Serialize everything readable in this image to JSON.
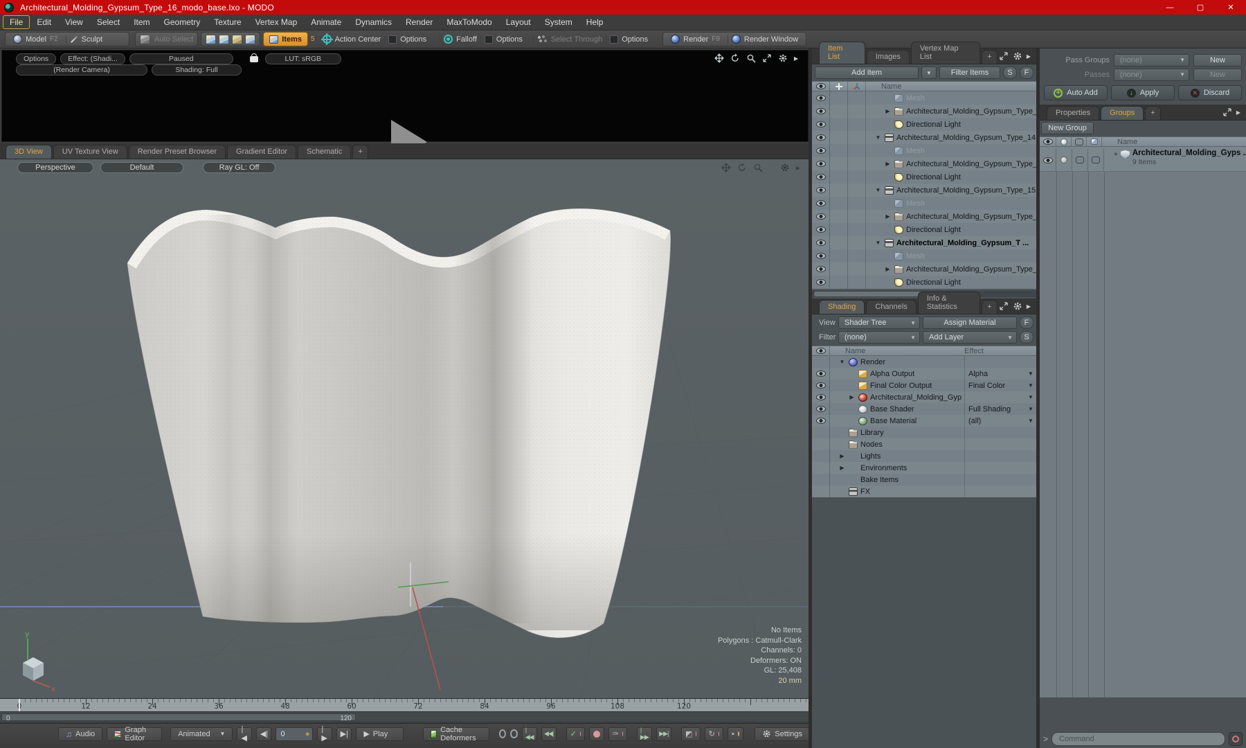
{
  "window": {
    "title": "Architectural_Molding_Gypsum_Type_16_modo_base.lxo - MODO"
  },
  "menu": {
    "items": [
      {
        "label": "File",
        "active": true
      },
      {
        "label": "Edit"
      },
      {
        "label": "View"
      },
      {
        "label": "Select"
      },
      {
        "label": "Item"
      },
      {
        "label": "Geometry"
      },
      {
        "label": "Texture"
      },
      {
        "label": "Vertex Map"
      },
      {
        "label": "Animate"
      },
      {
        "label": "Dynamics"
      },
      {
        "label": "Render"
      },
      {
        "label": "MaxToModo"
      },
      {
        "label": "Layout"
      },
      {
        "label": "System"
      },
      {
        "label": "Help"
      }
    ]
  },
  "toolbar": {
    "model": "Model",
    "model_key": "F2",
    "sculpt": "Sculpt",
    "auto_select": "Auto Select",
    "items": "Items",
    "items_count": "5",
    "action_center": "Action Center",
    "options1": "Options",
    "falloff": "Falloff",
    "options2": "Options",
    "select_through": "Select Through",
    "options3": "Options",
    "render": "Render",
    "render_key": "F9",
    "render_window": "Render Window"
  },
  "preview": {
    "options": "Options",
    "effect": "Effect: (Shadi...",
    "paused": "Paused",
    "lut": "LUT: sRGB",
    "camera": "(Render Camera)",
    "shading": "Shading: Full"
  },
  "viewport": {
    "tabs": [
      {
        "label": "3D View",
        "active": true
      },
      {
        "label": "UV Texture View"
      },
      {
        "label": "Render Preset Browser"
      },
      {
        "label": "Gradient Editor"
      },
      {
        "label": "Schematic"
      },
      {
        "label": "+"
      }
    ],
    "projection": "Perspective",
    "style": "Default",
    "raygl": "Ray GL: Off",
    "stats": [
      {
        "text": "No Items"
      },
      {
        "text": "Polygons : Catmull-Clark"
      },
      {
        "text": "Channels: 0"
      },
      {
        "text": "Deformers: ON"
      },
      {
        "text": "GL: 25,408"
      },
      {
        "text": "20 mm"
      }
    ],
    "gizmo_y_label": "y",
    "gizmo_x_label": "x"
  },
  "timeline": {
    "labels": [
      {
        "v": "0"
      },
      {
        "v": "12"
      },
      {
        "v": "24"
      },
      {
        "v": "36"
      },
      {
        "v": "48"
      },
      {
        "v": "60"
      },
      {
        "v": "72"
      },
      {
        "v": "84"
      },
      {
        "v": "96"
      },
      {
        "v": "108"
      },
      {
        "v": "120"
      }
    ],
    "range_start": "0",
    "range_end": "120"
  },
  "transport": {
    "audio": "Audio",
    "graph_editor": "Graph Editor",
    "anim_mode": "Animated",
    "frame": "0",
    "play": "Play",
    "cache_deformers": "Cache Deformers",
    "settings": "Settings"
  },
  "item_list": {
    "tabs": [
      {
        "label": "Item List",
        "active": true
      },
      {
        "label": "Images"
      },
      {
        "label": "Vertex Map List"
      },
      {
        "label": "+"
      }
    ],
    "add_item": "Add Item",
    "filter_placeholder": "Filter Items",
    "btn_s": "S",
    "btn_f": "F",
    "col_name": "Name",
    "rows": [
      {
        "icon": "mesh",
        "label": "Mesh",
        "depth": 2,
        "dim": true
      },
      {
        "icon": "folder",
        "label": "Architectural_Molding_Gypsum_Type_ ...",
        "depth": 2,
        "expander": "closed"
      },
      {
        "icon": "light",
        "label": "Directional Light",
        "depth": 2
      },
      {
        "icon": "group",
        "label": "Architectural_Molding_Gypsum_Type_14 ...",
        "depth": 1,
        "expander": "open"
      },
      {
        "icon": "mesh",
        "label": "Mesh",
        "depth": 2,
        "dim": true
      },
      {
        "icon": "folder",
        "label": "Architectural_Molding_Gypsum_Type_ ...",
        "depth": 2,
        "expander": "closed"
      },
      {
        "icon": "light",
        "label": "Directional Light",
        "depth": 2
      },
      {
        "icon": "group",
        "label": "Architectural_Molding_Gypsum_Type_15 ...",
        "depth": 1,
        "expander": "open"
      },
      {
        "icon": "mesh",
        "label": "Mesh",
        "depth": 2,
        "dim": true
      },
      {
        "icon": "folder",
        "label": "Architectural_Molding_Gypsum_Type_ ...",
        "depth": 2,
        "expander": "closed"
      },
      {
        "icon": "light",
        "label": "Directional Light",
        "depth": 2
      },
      {
        "icon": "group",
        "label": "Architectural_Molding_Gypsum_T ...",
        "depth": 1,
        "expander": "open",
        "bold": true
      },
      {
        "icon": "mesh",
        "label": "Mesh",
        "depth": 2,
        "dim": true
      },
      {
        "icon": "folder",
        "label": "Architectural_Molding_Gypsum_Type_ ...",
        "depth": 2,
        "expander": "closed"
      },
      {
        "icon": "light",
        "label": "Directional Light",
        "depth": 2
      }
    ]
  },
  "shading": {
    "tabs": [
      {
        "label": "Shading",
        "active": true
      },
      {
        "label": "Channels"
      },
      {
        "label": "Info & Statistics"
      },
      {
        "label": "+"
      }
    ],
    "view_label": "View",
    "view_value": "Shader Tree",
    "assign_material": "Assign Material",
    "btn_f": "F",
    "filter_label": "Filter",
    "filter_value": "(none)",
    "add_layer": "Add Layer",
    "btn_s": "S",
    "col_name": "Name",
    "col_effect": "Effect",
    "rows": [
      {
        "icon": "sphere-purple",
        "label": "Render",
        "depth": 1,
        "expander": "open",
        "effect": ""
      },
      {
        "eye": true,
        "icon": "image",
        "label": "Alpha Output",
        "depth": 2,
        "effect": "Alpha",
        "dropdown": true
      },
      {
        "eye": true,
        "icon": "image",
        "label": "Final Color Output",
        "depth": 2,
        "effect": "Final Color",
        "dropdown": true
      },
      {
        "eye": true,
        "icon": "sphere-red",
        "label": "Architectural_Molding_Gyp ...",
        "depth": 2,
        "expander": "closed",
        "effect": "",
        "dropdown": true
      },
      {
        "eye": true,
        "icon": "sphere-white",
        "label": "Base Shader",
        "depth": 2,
        "effect": "Full Shading",
        "dropdown": true
      },
      {
        "eye": true,
        "icon": "sphere-green",
        "label": "Base Material",
        "depth": 2,
        "effect": "(all)",
        "dropdown": true
      },
      {
        "icon": "folder",
        "label": "Library",
        "depth": 1,
        "effect": ""
      },
      {
        "icon": "folder",
        "label": "Nodes",
        "depth": 1,
        "effect": ""
      },
      {
        "label": "Lights",
        "depth": 1,
        "expander": "closed",
        "effect": ""
      },
      {
        "label": "Environments",
        "depth": 1,
        "expander": "closed",
        "effect": ""
      },
      {
        "label": "Bake Items",
        "depth": 1,
        "effect": ""
      },
      {
        "icon": "group",
        "label": "FX",
        "depth": 1,
        "effect": ""
      }
    ]
  },
  "passes": {
    "pass_groups_label": "Pass Groups",
    "pass_groups_value": "(none)",
    "new1": "New",
    "passes_label": "Passes",
    "passes_value": "(none)",
    "new2": "New",
    "auto_add": "Auto Add",
    "apply": "Apply",
    "discard": "Discard"
  },
  "groups": {
    "tabs": [
      {
        "label": "Properties"
      },
      {
        "label": "Groups",
        "active": true
      },
      {
        "label": "+"
      }
    ],
    "new_group": "New Group",
    "col_name": "Name",
    "row_name": "Architectural_Molding_Gyps ...",
    "row_sub": "9 Items"
  },
  "command": {
    "prompt": ">",
    "placeholder": "Command"
  }
}
